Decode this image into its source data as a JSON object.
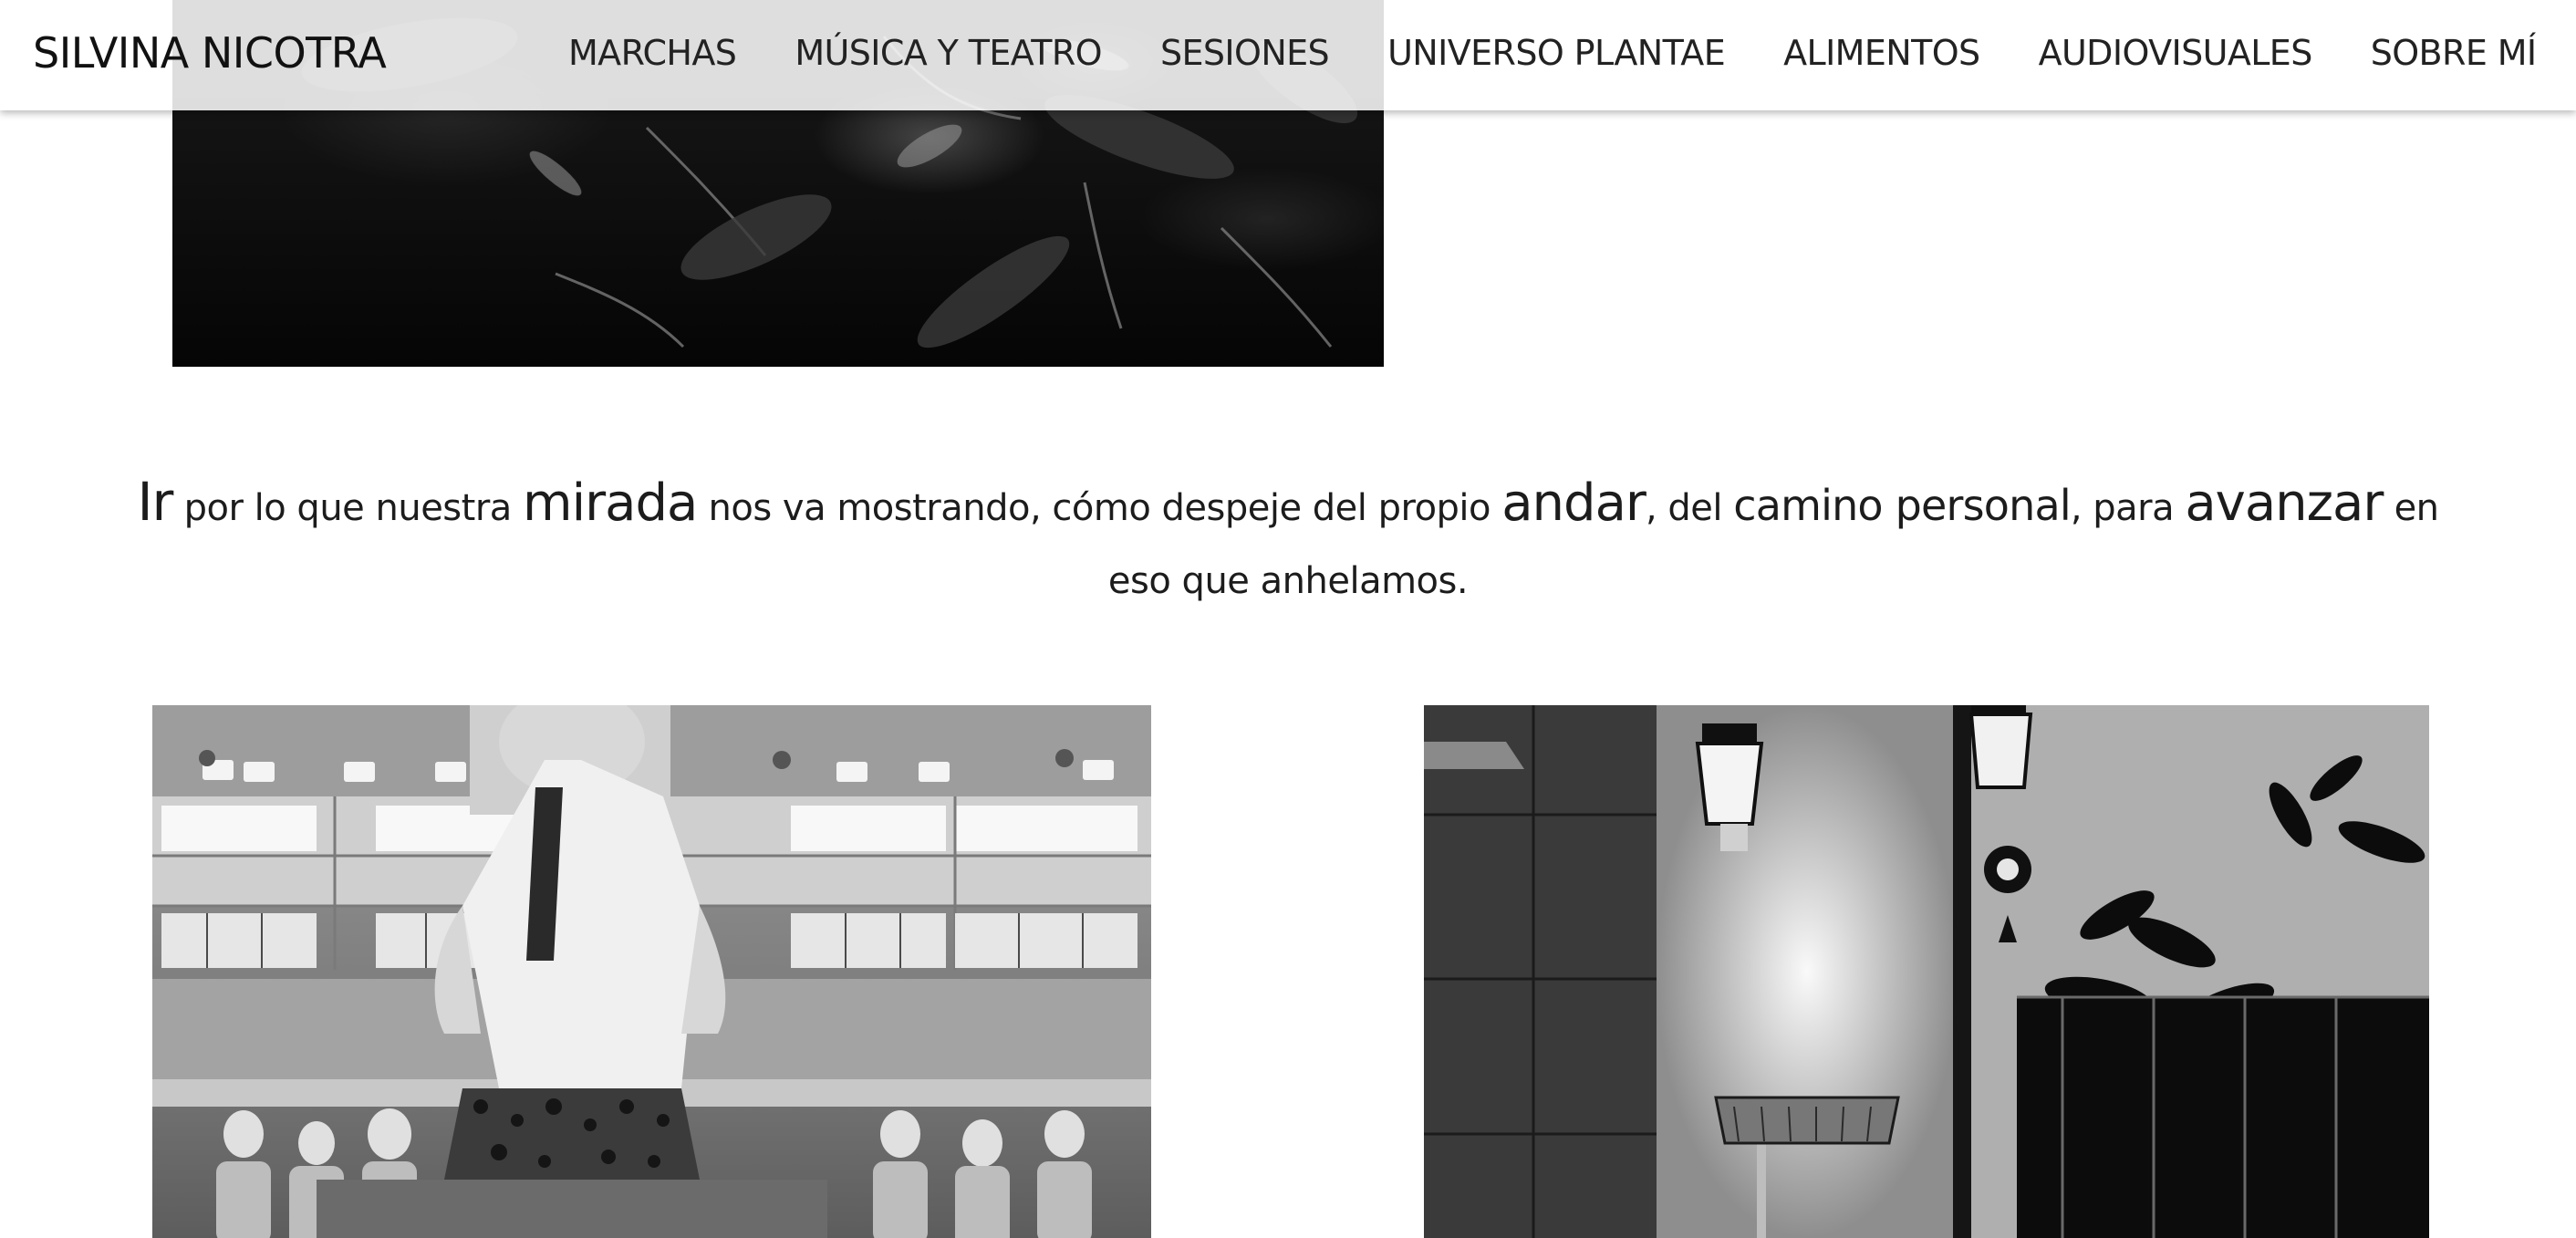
{
  "header": {
    "brand": "SILVINA NICOTRA",
    "nav": [
      {
        "label": "MARCHAS"
      },
      {
        "label": "MÚSICA Y TEATRO"
      },
      {
        "label": "SESIONES"
      },
      {
        "label": "UNIVERSO PLANTAE"
      },
      {
        "label": "ALIMENTOS"
      },
      {
        "label": "AUDIOVISUALES"
      },
      {
        "label": "SOBRE MÍ"
      }
    ]
  },
  "tagline": {
    "w1": "Ir",
    "t1": " por lo que nuestra ",
    "w2": "mirada",
    "t2": " nos va mostrando, cómo despeje del propio ",
    "w3": "andar",
    "t3": ", del ",
    "w4": "camino personal",
    "t4": ", para ",
    "w5": "avanzar",
    "t5": " en eso que anhelamos."
  },
  "colors": {
    "background": "#ffffff",
    "text": "#111111",
    "header_bg": "rgba(255,255,255,0.86)"
  }
}
